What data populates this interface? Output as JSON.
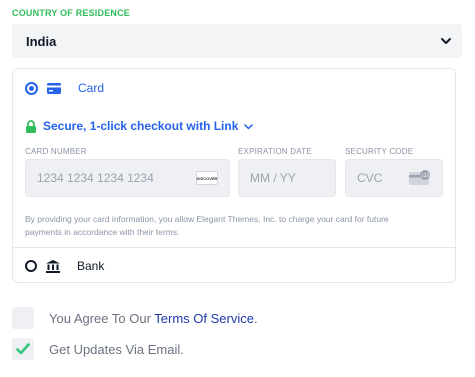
{
  "country": {
    "label": "COUNTRY OF RESIDENCE",
    "selected": "India"
  },
  "payment": {
    "card_label": "Card",
    "link_text": "Secure, 1-click checkout with Link",
    "card_number": {
      "label": "CARD NUMBER",
      "placeholder": "1234 1234 1234 1234",
      "brand": "DISCOVER"
    },
    "expiration": {
      "label": "EXPIRATION DATE",
      "placeholder": "MM / YY"
    },
    "security": {
      "label": "SECURITY CODE",
      "placeholder": "CVC"
    },
    "note": "By providing your card information, you allow Elegant Themes, Inc. to charge your card for future payments in accordance with their terms.",
    "bank_label": "Bank"
  },
  "agreements": {
    "terms_prefix": "You Agree To Our ",
    "terms_link": "Terms Of Service",
    "terms_suffix": ".",
    "updates_label": "Get Updates Via Email.",
    "terms_checked": false,
    "updates_checked": true
  },
  "colors": {
    "accent_green": "#2fbd5a",
    "link_blue": "#2563eb",
    "checkbox_check": "#34c77b"
  }
}
